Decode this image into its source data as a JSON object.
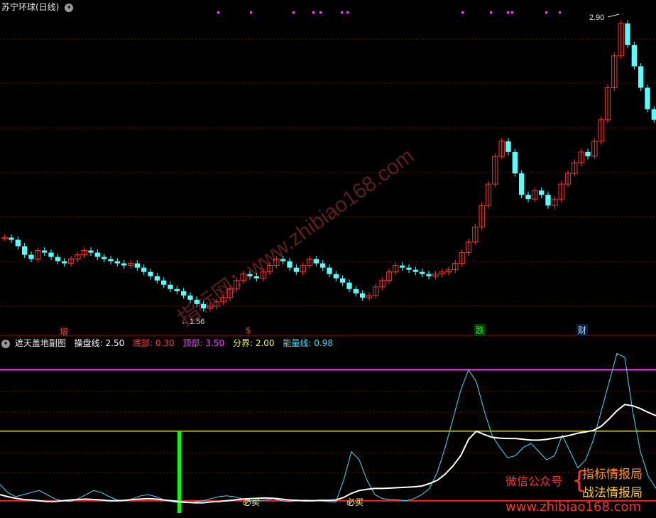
{
  "main_panel": {
    "title": "苏宁环球(日线)",
    "high_label": "2.90",
    "low_label": "1.56",
    "markers": [
      {
        "text": "增",
        "color": "#ff4040"
      },
      {
        "text": "$",
        "color": "#ff4040"
      },
      {
        "text": "跌",
        "color": "#00ff00"
      },
      {
        "text": "财",
        "color": "#a0e0ff"
      }
    ],
    "watermark": "指标网：www.zhibiao168.com"
  },
  "indicator_panel": {
    "title": "遮天盖地副图",
    "params": [
      {
        "label": "操盘线:",
        "value": "2.50",
        "color": "#ffffff"
      },
      {
        "label": "底部:",
        "value": "0.30",
        "color": "#ff4040"
      },
      {
        "label": "顶部:",
        "value": "3.50",
        "color": "#ff40ff"
      },
      {
        "label": "分界:",
        "value": "2.00",
        "color": "#ffff40"
      },
      {
        "label": "能量线:",
        "value": "0.98",
        "color": "#40e0ff"
      }
    ],
    "buy_labels": [
      "必买",
      "必买"
    ]
  },
  "promo": {
    "wechat": "微信公众号",
    "line1": "指标情报局",
    "line2": "战法情报局",
    "url": "www.zhibiao168.com"
  },
  "colors": {
    "up": "#ff3232",
    "down": "#54ffff",
    "grid": "#8b0000",
    "operating_line": "#ffffff",
    "energy_line": "#40e0ff",
    "bottom_line": "#ff2020",
    "top_line": "#ff30ff",
    "divider_line": "#ffff40",
    "buy_bar": "#00ff00"
  },
  "chart_data": {
    "type": "candlestick",
    "series": [
      {
        "name": "K线",
        "values": [
          1.9,
          1.89,
          1.86,
          1.82,
          1.8,
          1.84,
          1.83,
          1.81,
          1.79,
          1.78,
          1.8,
          1.82,
          1.84,
          1.83,
          1.81,
          1.8,
          1.79,
          1.78,
          1.77,
          1.78,
          1.76,
          1.74,
          1.72,
          1.7,
          1.68,
          1.66,
          1.65,
          1.63,
          1.61,
          1.59,
          1.57,
          1.58,
          1.6,
          1.62,
          1.66,
          1.7,
          1.73,
          1.72,
          1.71,
          1.74,
          1.77,
          1.8,
          1.79,
          1.76,
          1.74,
          1.77,
          1.8,
          1.78,
          1.76,
          1.73,
          1.71,
          1.69,
          1.66,
          1.64,
          1.62,
          1.63,
          1.67,
          1.7,
          1.74,
          1.77,
          1.76,
          1.75,
          1.74,
          1.73,
          1.72,
          1.73,
          1.74,
          1.75,
          1.78,
          1.83,
          1.88,
          1.95,
          2.05,
          2.15,
          2.28,
          2.35,
          2.3,
          2.2,
          2.1,
          2.08,
          2.12,
          2.1,
          2.05,
          2.08,
          2.15,
          2.2,
          2.25,
          2.3,
          2.28,
          2.35,
          2.45,
          2.6,
          2.75,
          2.9,
          2.8,
          2.7,
          2.6,
          2.5,
          2.45
        ]
      },
      {
        "name": "操盘线",
        "values": [
          0.45,
          0.4,
          0.36,
          0.33,
          0.32,
          0.3,
          0.28,
          0.28,
          0.3,
          0.32,
          0.33,
          0.34,
          0.33,
          0.32,
          0.3,
          0.3,
          0.31,
          0.33,
          0.34,
          0.35,
          0.34,
          0.32,
          0.3,
          0.28,
          0.26,
          0.25,
          0.25,
          0.27,
          0.28,
          0.3,
          0.32,
          0.34,
          0.35,
          0.36,
          0.37,
          0.36,
          0.34,
          0.32,
          0.31,
          0.3,
          0.3,
          0.31,
          0.31,
          0.32,
          0.38,
          0.48,
          0.55,
          0.58,
          0.6,
          0.6,
          0.61,
          0.62,
          0.63,
          0.64,
          0.66,
          0.72,
          0.8,
          0.95,
          1.15,
          1.4,
          1.8,
          2.0,
          1.92,
          1.85,
          1.83,
          1.82,
          1.82,
          1.8,
          1.78,
          1.78,
          1.8,
          1.83,
          1.86,
          1.9,
          1.95,
          1.98,
          2.02,
          2.12,
          2.3,
          2.5,
          2.65,
          2.62,
          2.55,
          2.46,
          2.38
        ]
      },
      {
        "name": "能量线",
        "values": [
          0.7,
          0.5,
          0.4,
          0.45,
          0.5,
          0.55,
          0.45,
          0.35,
          0.3,
          0.28,
          0.35,
          0.45,
          0.55,
          0.5,
          0.4,
          0.32,
          0.3,
          0.35,
          0.42,
          0.45,
          0.4,
          0.32,
          0.28,
          0.25,
          0.25,
          0.27,
          0.3,
          0.35,
          0.4,
          0.42,
          0.4,
          0.35,
          0.3,
          0.3,
          0.32,
          0.35,
          0.3,
          0.28,
          0.3,
          0.32,
          0.31,
          0.3,
          0.28,
          0.27,
          0.8,
          1.5,
          1.3,
          0.8,
          0.45,
          0.35,
          0.33,
          0.32,
          0.3,
          0.35,
          0.45,
          0.6,
          1.0,
          1.6,
          2.3,
          3.0,
          3.5,
          3.2,
          2.5,
          1.9,
          1.6,
          1.35,
          1.4,
          1.6,
          1.7,
          1.5,
          1.3,
          1.4,
          1.9,
          1.5,
          1.1,
          1.3,
          1.8,
          2.5,
          3.2,
          3.9,
          3.8,
          2.5,
          1.5,
          0.9,
          0.6
        ]
      }
    ]
  }
}
